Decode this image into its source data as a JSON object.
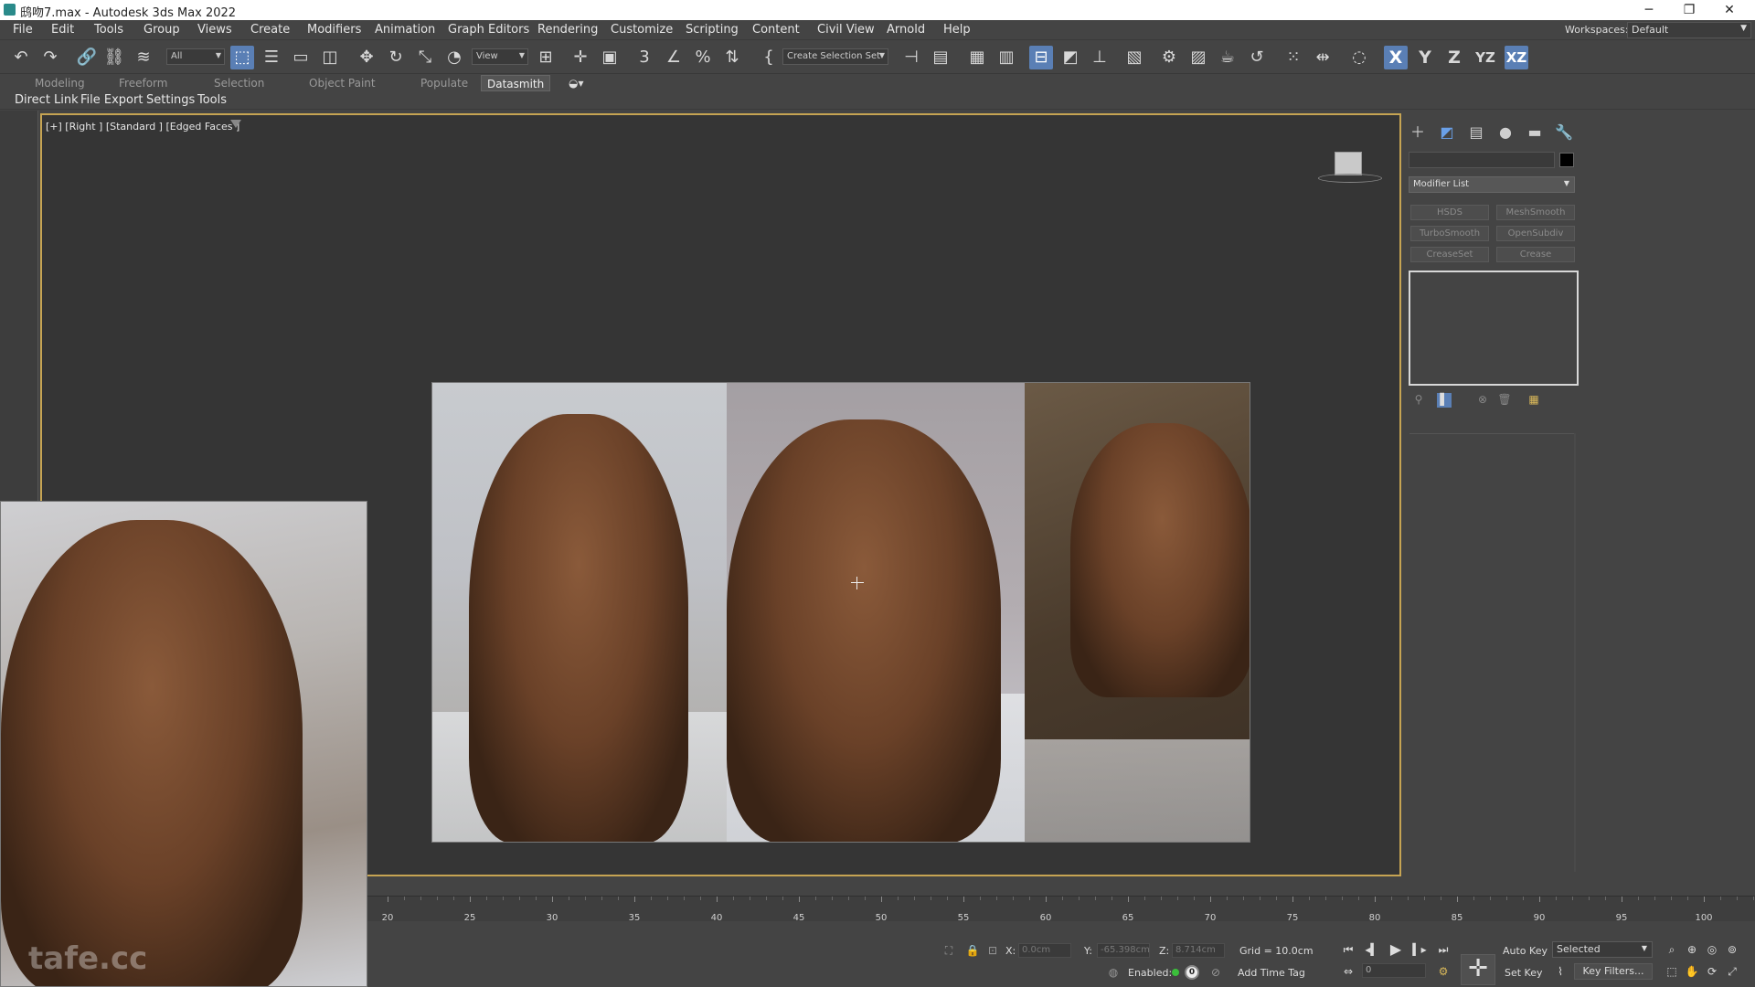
{
  "titlebar": {
    "title": "鸱吻7.max - Autodesk 3ds Max 2022",
    "minimize": "─",
    "restore": "❐",
    "close": "✕"
  },
  "menu": {
    "items": [
      "File",
      "Edit",
      "Tools",
      "Group",
      "Views",
      "Create",
      "Modifiers",
      "Animation",
      "Graph Editors",
      "Rendering",
      "Customize",
      "Scripting",
      "Content",
      "Civil View",
      "Arnold",
      "Help"
    ],
    "workspaces_label": "Workspaces:",
    "workspace_value": "Default"
  },
  "toolbar": {
    "selection_filter": "All",
    "ref_coord": "View",
    "named_selection": "Create Selection Set",
    "axis_x": "X",
    "axis_y": "Y",
    "axis_z": "Z",
    "axis_yz": "YZ",
    "axis_zx": "XZ"
  },
  "ribbon": {
    "tabs": [
      "Modeling",
      "Freeform",
      "Selection",
      "Object Paint",
      "Populate",
      "Datasmith"
    ],
    "active": "Datasmith"
  },
  "datasmith": {
    "items": [
      "Direct Link",
      "File Export",
      "Settings",
      "Tools"
    ]
  },
  "viewport": {
    "label": "[+] [Right ] [Standard ] [Edged Faces ]",
    "watermark": "tafe.cc"
  },
  "command_panel": {
    "modifier_list": "Modifier List",
    "buttons": [
      "HSDS",
      "MeshSmooth",
      "TurboSmooth",
      "OpenSubdiv",
      "CreaseSet",
      "Crease"
    ]
  },
  "timeline": {
    "ticks": [
      "20",
      "25",
      "30",
      "35",
      "40",
      "45",
      "50",
      "55",
      "60",
      "65",
      "70",
      "75",
      "80",
      "85",
      "90",
      "95",
      "100"
    ]
  },
  "status": {
    "x_label": "X:",
    "x_value": "0.0cm",
    "y_label": "Y:",
    "y_value": "-65.398cm",
    "z_label": "Z:",
    "z_value": "8.714cm",
    "grid": "Grid = 10.0cm",
    "enabled_label": "Enabled:",
    "enabled_count": "0",
    "add_time_tag": "Add Time Tag",
    "auto_key": "Auto Key",
    "set_key": "Set Key",
    "selected": "Selected",
    "key_filters": "Key Filters...",
    "frame": "0"
  }
}
